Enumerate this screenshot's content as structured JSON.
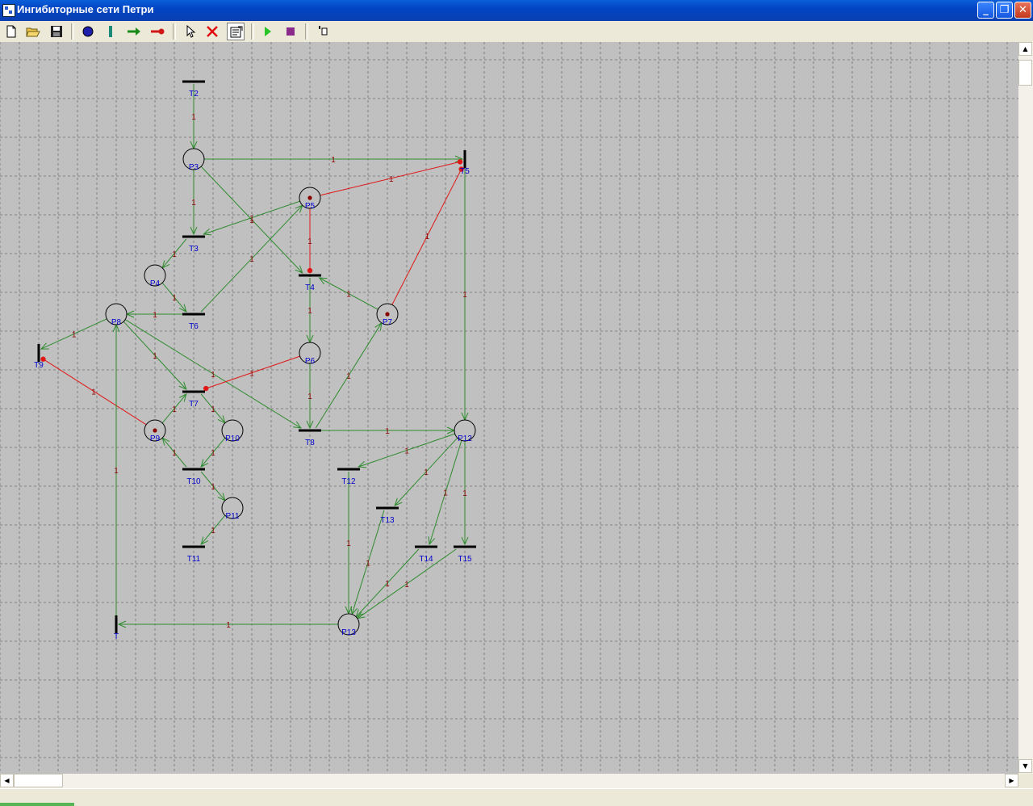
{
  "window": {
    "title": "Ингибиторные сети Петри"
  },
  "toolbar": {
    "buttons": [
      {
        "name": "new-icon",
        "tooltip": ""
      },
      {
        "name": "open-icon",
        "tooltip": ""
      },
      {
        "name": "save-icon",
        "tooltip": ""
      },
      {
        "name": "place-tool-icon",
        "tooltip": ""
      },
      {
        "name": "transition-tool-icon",
        "tooltip": ""
      },
      {
        "name": "arc-tool-icon",
        "tooltip": ""
      },
      {
        "name": "inhibitor-arc-tool-icon",
        "tooltip": ""
      },
      {
        "name": "select-icon",
        "tooltip": ""
      },
      {
        "name": "delete-icon",
        "tooltip": ""
      },
      {
        "name": "properties-icon",
        "tooltip": ""
      },
      {
        "name": "run-icon",
        "tooltip": ""
      },
      {
        "name": "stop-icon",
        "tooltip": ""
      },
      {
        "name": "step-icon",
        "tooltip": ""
      }
    ]
  },
  "colors": {
    "normal_arc": "#2e8b2e",
    "inhibitor_arc": "#e01818",
    "label": "#0000cc",
    "weight": "#8b0000",
    "token": "#8b0000"
  },
  "net": {
    "places": [
      {
        "id": "P3",
        "label": "P3",
        "tokens": 0
      },
      {
        "id": "P4",
        "label": "P4",
        "tokens": 0
      },
      {
        "id": "P5",
        "label": "P5",
        "tokens": 1
      },
      {
        "id": "P6",
        "label": "P6",
        "tokens": 0
      },
      {
        "id": "P7",
        "label": "P7",
        "tokens": 1
      },
      {
        "id": "P8",
        "label": "P8",
        "tokens": 0
      },
      {
        "id": "P9",
        "label": "P9",
        "tokens": 1
      },
      {
        "id": "P10",
        "label": "P10",
        "tokens": 0
      },
      {
        "id": "P11",
        "label": "P11",
        "tokens": 0
      },
      {
        "id": "P12",
        "label": "P12",
        "tokens": 0
      },
      {
        "id": "P13",
        "label": "P13",
        "tokens": 0
      }
    ],
    "transitions": [
      {
        "id": "T2",
        "label": "T2",
        "orientation": "horizontal"
      },
      {
        "id": "T3",
        "label": "T3",
        "orientation": "horizontal"
      },
      {
        "id": "T4",
        "label": "T4",
        "orientation": "horizontal"
      },
      {
        "id": "T5",
        "label": "T5",
        "orientation": "vertical"
      },
      {
        "id": "T6",
        "label": "T6",
        "orientation": "horizontal"
      },
      {
        "id": "T7",
        "label": "T7",
        "orientation": "horizontal"
      },
      {
        "id": "T8",
        "label": "T8",
        "orientation": "horizontal"
      },
      {
        "id": "T9",
        "label": "T9",
        "orientation": "vertical"
      },
      {
        "id": "T10",
        "label": "T10",
        "orientation": "horizontal"
      },
      {
        "id": "T11",
        "label": "T11",
        "orientation": "horizontal"
      },
      {
        "id": "T12",
        "label": "T12",
        "orientation": "horizontal"
      },
      {
        "id": "T13",
        "label": "T13",
        "orientation": "horizontal"
      },
      {
        "id": "T14",
        "label": "T14",
        "orientation": "horizontal"
      },
      {
        "id": "T15",
        "label": "T15",
        "orientation": "horizontal"
      },
      {
        "id": "T",
        "label": "T",
        "orientation": "vertical"
      }
    ],
    "arcs": [
      {
        "from": "T2",
        "to": "P3",
        "weight": "1",
        "kind": "normal"
      },
      {
        "from": "P3",
        "to": "T5",
        "weight": "1",
        "kind": "normal"
      },
      {
        "from": "P3",
        "to": "T3",
        "weight": "1",
        "kind": "normal"
      },
      {
        "from": "P3",
        "to": "T4",
        "weight": "1",
        "kind": "normal"
      },
      {
        "from": "P5",
        "to": "T3",
        "weight": "1",
        "kind": "normal"
      },
      {
        "from": "P5",
        "to": "T5",
        "weight": "1",
        "kind": "inhibitor"
      },
      {
        "from": "P5",
        "to": "T4",
        "weight": "1",
        "kind": "inhibitor"
      },
      {
        "from": "T3",
        "to": "P4",
        "weight": "1",
        "kind": "normal"
      },
      {
        "from": "P4",
        "to": "T6",
        "weight": "1",
        "kind": "normal"
      },
      {
        "from": "T6",
        "to": "P8",
        "weight": "1",
        "kind": "normal"
      },
      {
        "from": "T6",
        "to": "P5",
        "weight": "1",
        "kind": "normal"
      },
      {
        "from": "T4",
        "to": "P6",
        "weight": "1",
        "kind": "normal"
      },
      {
        "from": "P7",
        "to": "T4",
        "weight": "1",
        "kind": "normal"
      },
      {
        "from": "P7",
        "to": "T5",
        "weight": "1",
        "kind": "inhibitor"
      },
      {
        "from": "T5",
        "to": "P12",
        "weight": "1",
        "kind": "normal"
      },
      {
        "from": "P8",
        "to": "T9",
        "weight": "1",
        "kind": "normal"
      },
      {
        "from": "P8",
        "to": "T7",
        "weight": "1",
        "kind": "normal"
      },
      {
        "from": "P8",
        "to": "T8",
        "weight": "1",
        "kind": "normal"
      },
      {
        "from": "P6",
        "to": "T7",
        "weight": "1",
        "kind": "inhibitor"
      },
      {
        "from": "P6",
        "to": "T8",
        "weight": "1",
        "kind": "normal"
      },
      {
        "from": "T8",
        "to": "P7",
        "weight": "1",
        "kind": "normal"
      },
      {
        "from": "T8",
        "to": "P12",
        "weight": "1",
        "kind": "normal"
      },
      {
        "from": "P9",
        "to": "T7",
        "weight": "1",
        "kind": "normal"
      },
      {
        "from": "P9",
        "to": "T9",
        "weight": "1",
        "kind": "inhibitor"
      },
      {
        "from": "T7",
        "to": "P10",
        "weight": "1",
        "kind": "normal"
      },
      {
        "from": "P10",
        "to": "T10",
        "weight": "1",
        "kind": "normal"
      },
      {
        "from": "T10",
        "to": "P9",
        "weight": "1",
        "kind": "normal"
      },
      {
        "from": "T10",
        "to": "P11",
        "weight": "1",
        "kind": "normal"
      },
      {
        "from": "P11",
        "to": "T11",
        "weight": "1",
        "kind": "normal"
      },
      {
        "from": "P12",
        "to": "T12",
        "weight": "1",
        "kind": "normal"
      },
      {
        "from": "P12",
        "to": "T13",
        "weight": "1",
        "kind": "normal"
      },
      {
        "from": "P12",
        "to": "T14",
        "weight": "1",
        "kind": "normal"
      },
      {
        "from": "P12",
        "to": "T15",
        "weight": "1",
        "kind": "normal"
      },
      {
        "from": "T12",
        "to": "P13",
        "weight": "1",
        "kind": "normal"
      },
      {
        "from": "T13",
        "to": "P13",
        "weight": "1",
        "kind": "normal"
      },
      {
        "from": "T14",
        "to": "P13",
        "weight": "1",
        "kind": "normal"
      },
      {
        "from": "T15",
        "to": "P13",
        "weight": "1",
        "kind": "normal"
      },
      {
        "from": "P13",
        "to": "T",
        "weight": "1",
        "kind": "normal"
      },
      {
        "from": "T",
        "to": "P8",
        "weight": "1",
        "kind": "normal"
      }
    ]
  }
}
